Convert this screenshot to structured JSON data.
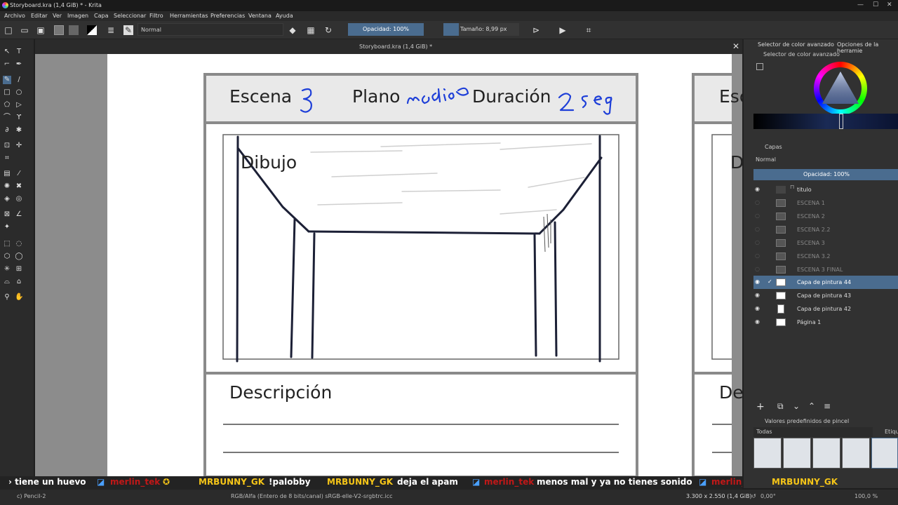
{
  "window": {
    "title": "Storyboard.kra (1,4 GiB) * - Krita"
  },
  "menu": [
    "Archivo",
    "Editar",
    "Ver",
    "Imagen",
    "Capa",
    "Seleccionar",
    "Filtro",
    "Herramientas",
    "Preferencias",
    "Ventana",
    "Ayuda"
  ],
  "toolbar": {
    "blend_mode": "Normal",
    "opacity": "Opacidad: 100%",
    "size": "Tamaño: 8,99 px"
  },
  "document": {
    "tab_title": "Storyboard.kra (1,4 GiB) *"
  },
  "canvas": {
    "scene_label": "Escena",
    "scene_value": "3",
    "shot_label": "Plano",
    "shot_value": "medio",
    "duration_label": "Duración",
    "duration_value": "2 seg",
    "drawing_label": "Dibujo",
    "description_label": "Descripción",
    "next_scene_label": "Esc",
    "next_drawing_label": "D",
    "next_description_label": "De"
  },
  "right_panel": {
    "tab_color": "Selector de color avanzado",
    "tab_tools": "Opciones de la herramie",
    "color_selector_title": "Selector de color avanzado",
    "layers_title": "Capas",
    "layers_blend": "Normal",
    "layers_opacity": "Opacidad:  100%",
    "layers": [
      {
        "name": "titulo",
        "visible": true,
        "active": false
      },
      {
        "name": "ESCENA 1",
        "visible": false,
        "active": false
      },
      {
        "name": "ESCENA 2",
        "visible": false,
        "active": false
      },
      {
        "name": "ESCENA 2.2",
        "visible": false,
        "active": false
      },
      {
        "name": "ESCENA 3",
        "visible": false,
        "active": false
      },
      {
        "name": "ESCENA 3.2",
        "visible": false,
        "active": false
      },
      {
        "name": "ESCENA 3 FINAL",
        "visible": false,
        "active": false
      },
      {
        "name": "Capa de pintura 44",
        "visible": true,
        "active": true
      },
      {
        "name": "Capa de pintura 43",
        "visible": true,
        "active": false
      },
      {
        "name": "Capa de pintura 42",
        "visible": true,
        "active": false
      },
      {
        "name": "Página 1",
        "visible": true,
        "active": false
      }
    ],
    "brush_presets_title": "Valores predefinidos de pincel",
    "brush_filter": "Todas",
    "brush_tag": "Etiqu"
  },
  "chat": {
    "seg1": "› tiene un huevo",
    "user1": "merlin_tek",
    "user2": "MRBUNNY_GK",
    "msg2": "!palobby",
    "user3": "MRBUNNY_GK",
    "msg3": "deja el apam",
    "user4": "merlin_tek",
    "msg4": "menos mal y ya no tienes sonido",
    "user5": "merlin_tek",
    "user6": "MRBUNNY_GK"
  },
  "status": {
    "brush": "c) Pencil-2",
    "color_space": "RGB/Alfa (Entero de 8 bits/canal)  sRGB-elle-V2-srgbtrc.icc",
    "dimensions": "3.300 x 2.550 (1,4 GiB)",
    "rotation": "0,00°",
    "zoom": "100,0 %"
  },
  "colors": {
    "accent": "#4a6c8f",
    "ink_blue": "#1e3fd8",
    "panel_gray": "#e9e9e9"
  }
}
